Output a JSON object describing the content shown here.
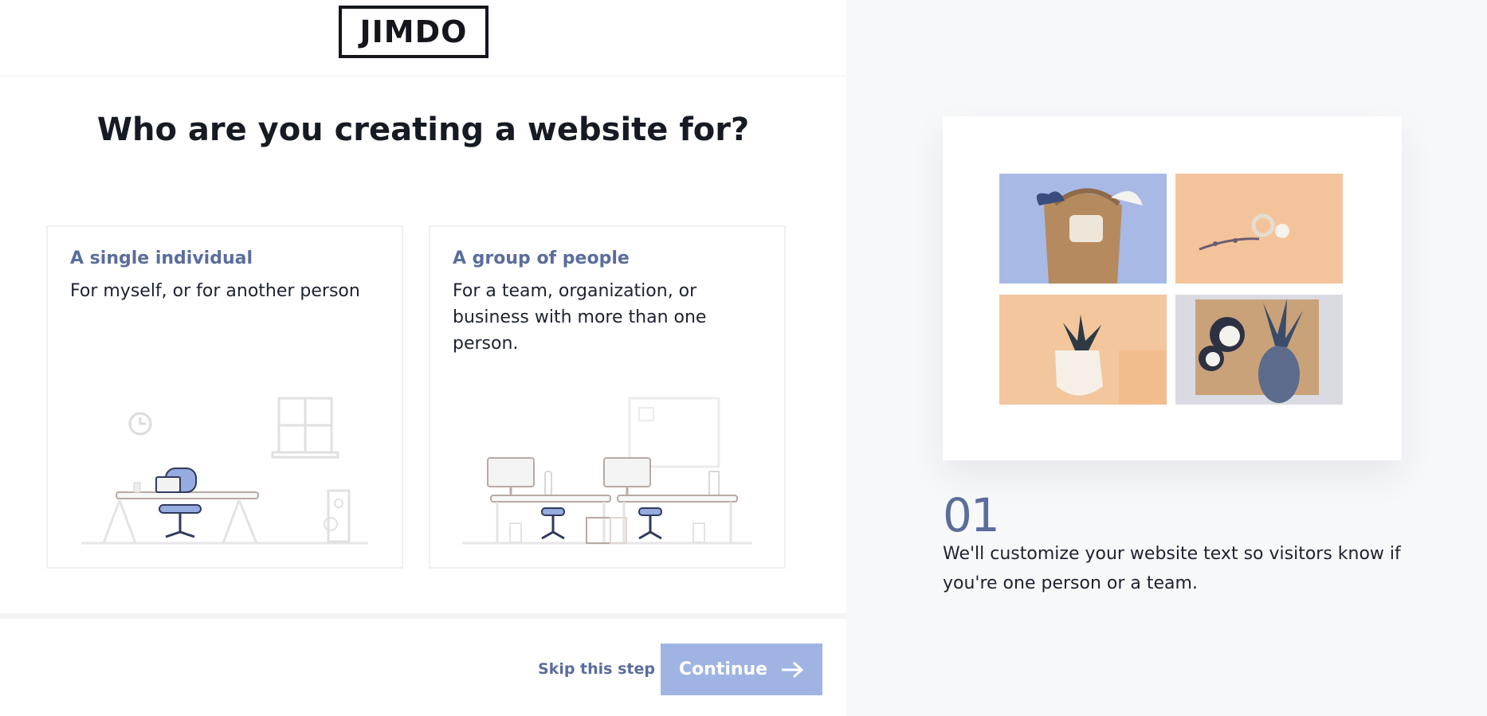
{
  "brand": {
    "logo_text": "JIMDO"
  },
  "question": {
    "title": "Who are you creating a website for?"
  },
  "options": [
    {
      "title": "A single individual",
      "description": "For myself, or for another person",
      "illustration": "single-desk-illustration"
    },
    {
      "title": "A group of people",
      "description": "For a team, organization, or business with more than one person.",
      "illustration": "team-desks-illustration"
    }
  ],
  "footer": {
    "skip_label": "Skip this step",
    "continue_label": "Continue",
    "continue_icon": "arrow-right-icon"
  },
  "sidebar": {
    "step_number": "01",
    "step_text": "We'll customize your website text so visitors know if you're one person or a team.",
    "preview_images": [
      "basket-photo",
      "jewelry-photo",
      "plant-vase-photo",
      "pineapple-coconut-photo"
    ]
  },
  "colors": {
    "accent": "#5a6d9c",
    "button_disabled": "#9fb4e3",
    "panel_bg": "#f7f8fa",
    "heading": "#161a23"
  }
}
